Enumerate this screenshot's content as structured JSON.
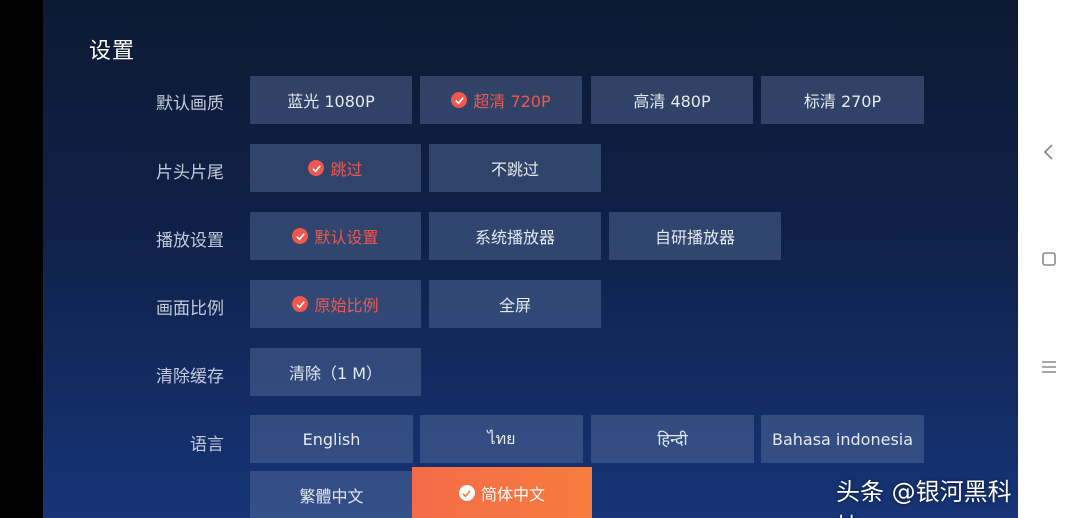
{
  "page": {
    "title": "设置"
  },
  "rows": [
    {
      "label": "默认画质",
      "options": [
        "蓝光 1080P",
        "超清 720P",
        "高清 480P",
        "标清 270P"
      ],
      "selected": 1
    },
    {
      "label": "片头片尾",
      "options": [
        "跳过",
        "不跳过"
      ],
      "selected": 0
    },
    {
      "label": "播放设置",
      "options": [
        "默认设置",
        "系统播放器",
        "自研播放器"
      ],
      "selected": 0
    },
    {
      "label": "画面比例",
      "options": [
        "原始比例",
        "全屏"
      ],
      "selected": 0
    },
    {
      "label": "清除缓存",
      "options": [
        "清除（1 M）"
      ],
      "selected": -1
    },
    {
      "label": "语言",
      "options": [
        "English",
        "ไทย",
        "हिन्दी",
        "Bahasa indonesia",
        "繁體中文",
        "简体中文"
      ],
      "selected": 5
    }
  ],
  "watermark": "头条 @银河黑科技",
  "navbar": {
    "icons": [
      "back-icon",
      "home-icon",
      "menu-icon"
    ]
  },
  "colors": {
    "accent": "#f0574e",
    "highlight": "#f77d3e",
    "option_bg": "#33456f"
  }
}
